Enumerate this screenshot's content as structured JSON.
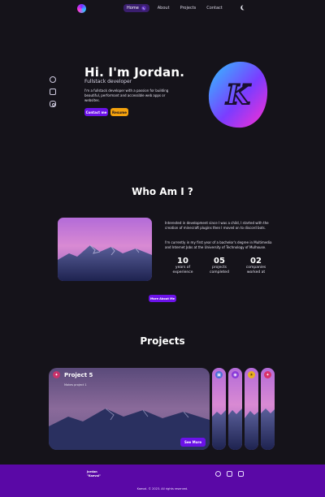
{
  "nav": {
    "links": [
      "Home",
      "About",
      "Projects",
      "Contact"
    ]
  },
  "hero": {
    "title": "Hi. I'm Jordan.",
    "subtitle": "Fullstack developer",
    "description": "I'm a fullstack developer with a passion for building beautiful, performant and accessible web apps or websites.",
    "contact_label": "Contact me",
    "resume_label": "Resume"
  },
  "about": {
    "title": "Who Am I ?",
    "paragraph1": "Interested in development since I was a child, I started with the creation of minecraft plugins then I moved on to discord bots.",
    "paragraph2": "I'm currently in my first year of a bachelor's degree in Multimedia and Internet Jobs at the University of Technology of Mulhouse.",
    "stats": [
      {
        "num": "10",
        "label_line1": "years of",
        "label_line2": "experience"
      },
      {
        "num": "05",
        "label_line1": "projects",
        "label_line2": "completed"
      },
      {
        "num": "02",
        "label_line1": "companies",
        "label_line2": "worked at"
      }
    ],
    "more_label": "More About Me"
  },
  "projects": {
    "title": "Projects",
    "featured": {
      "title": "Project 5",
      "description": "Makes project 1",
      "see_more": "See More"
    },
    "pills": [
      {
        "icon": "cube-icon",
        "color": "#4a6fd8"
      },
      {
        "icon": "circle-icon",
        "color": "#8a3ad8"
      },
      {
        "icon": "sun-icon",
        "color": "#e8b020"
      },
      {
        "icon": "flame-icon",
        "color": "#d8326a"
      }
    ]
  },
  "footer": {
    "brand_line1": "Jordan",
    "brand_line2": "\"Kaeval\"",
    "copyright": "Kaeval. © 2023. All rights reserved."
  },
  "colors": {
    "background": "#15131a",
    "accent": "#6b12e8",
    "resume": "#f4a20d",
    "footer": "#5a08a6"
  }
}
